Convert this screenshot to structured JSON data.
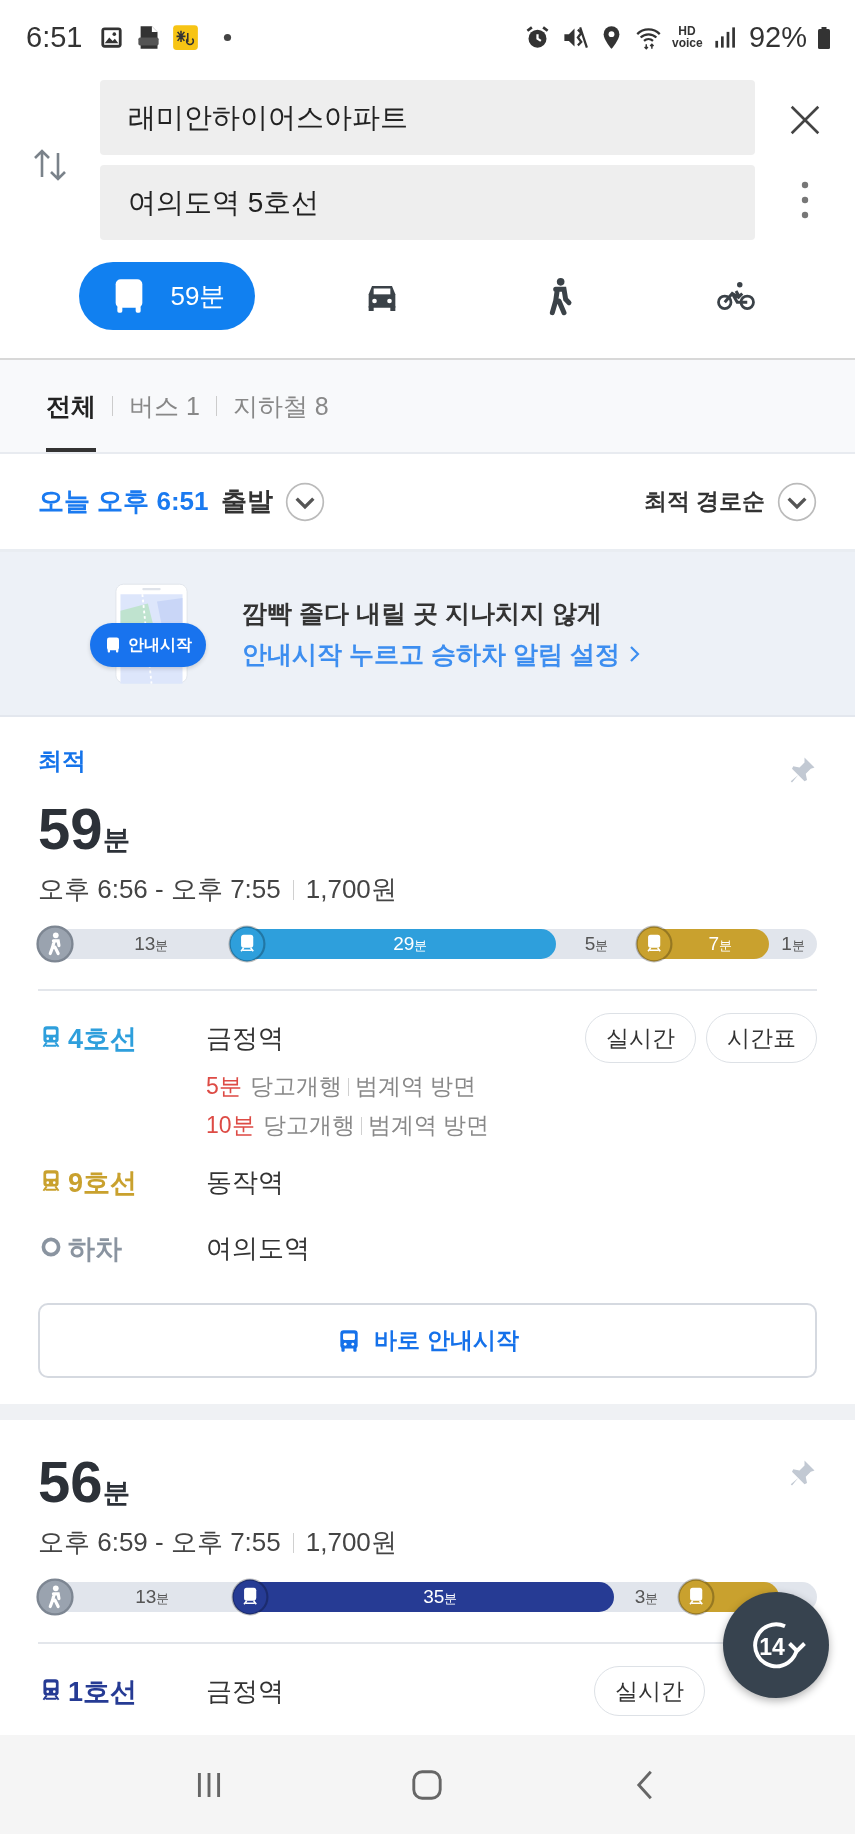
{
  "status_bar": {
    "time": "6:51",
    "hd": "HD voice",
    "battery": "92%"
  },
  "route": {
    "origin": "래미안하이어스아파트",
    "destination": "여의도역 5호선"
  },
  "modes": [
    {
      "kind": "transit",
      "label": "59분",
      "selected": true
    },
    {
      "kind": "car",
      "selected": false
    },
    {
      "kind": "walk",
      "selected": false
    },
    {
      "kind": "bike",
      "selected": false
    }
  ],
  "filter_tabs": [
    {
      "label": "전체",
      "selected": true
    },
    {
      "label": "버스 1",
      "selected": false
    },
    {
      "label": "지하철 8",
      "selected": false
    }
  ],
  "departure": {
    "time": "오늘 오후 6:51",
    "suffix": "출발",
    "sort": "최적 경로순"
  },
  "promo": {
    "badge": "안내시작",
    "headline": "깜빡 졸다 내릴 곳 지나치지 않게",
    "link": "안내시작 누르고 승하차 알림 설정"
  },
  "routes": [
    {
      "tag": "최적",
      "minutes": "59",
      "unit": "분",
      "times": "오후 6:56 - 오후 7:55",
      "fare": "1,700원",
      "segments": [
        {
          "kind": "walk",
          "value": "13",
          "unit": "분"
        },
        {
          "kind": "subway",
          "color": "#2e9fdc",
          "value": "29",
          "unit": "분"
        },
        {
          "kind": "walk",
          "value": "5",
          "unit": "분"
        },
        {
          "kind": "subway",
          "color": "#c9a12e",
          "value": "7",
          "unit": "분"
        },
        {
          "kind": "walk",
          "value": "1",
          "unit": "분"
        }
      ],
      "steps": [
        {
          "kind": "line",
          "line": "4호선",
          "color": "#2e9fdc",
          "station": "금정역",
          "buttons": [
            "실시간",
            "시간표"
          ],
          "arrivals": [
            {
              "wait": "5분",
              "dest": "당고개행",
              "dir": "범계역 방면"
            },
            {
              "wait": "10분",
              "dest": "당고개행",
              "dir": "범계역 방면"
            }
          ]
        },
        {
          "kind": "line",
          "line": "9호선",
          "color": "#c9a12e",
          "station": "동작역"
        },
        {
          "kind": "alight",
          "line": "하차",
          "station": "여의도역"
        }
      ],
      "action": "바로 안내시작"
    },
    {
      "minutes": "56",
      "unit": "분",
      "times": "오후 6:59 - 오후 7:55",
      "fare": "1,700원",
      "segments": [
        {
          "kind": "walk",
          "value": "13",
          "unit": "분"
        },
        {
          "kind": "subway",
          "color": "#263b94",
          "value": "35",
          "unit": "분"
        },
        {
          "kind": "walk",
          "value": "3",
          "unit": "분"
        },
        {
          "kind": "subway",
          "color": "#c9a12e"
        },
        {
          "kind": "walk"
        }
      ],
      "steps": [
        {
          "kind": "line",
          "line": "1호선",
          "color": "#263b94",
          "station": "금정역",
          "buttons": [
            "실시간"
          ]
        }
      ]
    }
  ],
  "fab": {
    "label": "14"
  }
}
